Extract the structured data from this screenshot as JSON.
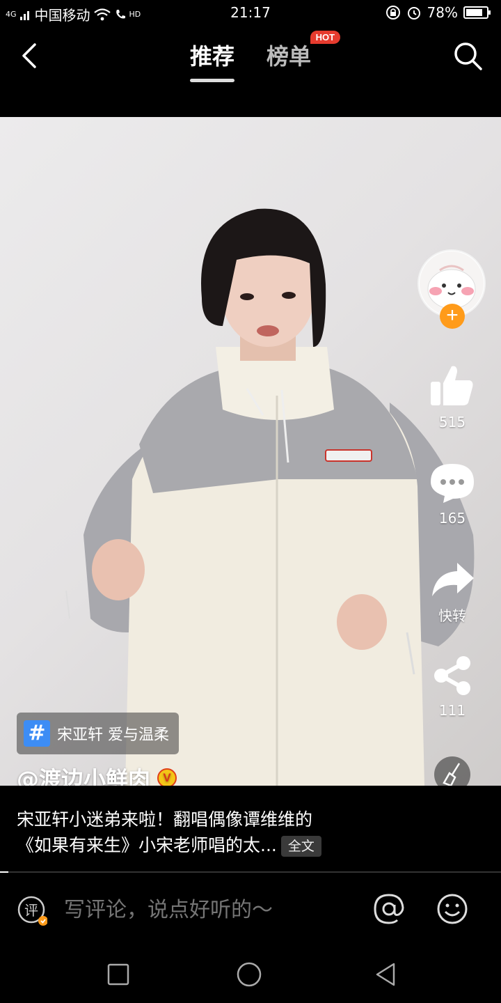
{
  "status_bar": {
    "network": "4G",
    "carrier": "中国移动",
    "call_badge": "HD",
    "time": "21:17",
    "battery": "78%"
  },
  "nav": {
    "tabs": [
      {
        "label": "推荐",
        "active": true
      },
      {
        "label": "榜单",
        "active": false
      }
    ],
    "hot_badge": "HOT"
  },
  "actions": {
    "like_count": "515",
    "comment_count": "165",
    "repost_label": "快转",
    "share_count": "111"
  },
  "topic": {
    "text": "宋亚轩 爱与温柔"
  },
  "author": {
    "name": "@渡边小鲜肉",
    "verified_mark": "V"
  },
  "caption": {
    "line1": "宋亚轩小迷弟来啦！翻唱偶像谭维维的",
    "line2": "《如果有来生》小宋老师唱的太...",
    "more_label": "全文"
  },
  "comment_bar": {
    "placeholder": "写评论，说点好听的～",
    "comment_icon_char": "评"
  },
  "colors": {
    "hot": "#e63b2e",
    "topic_hash": "#3d8df5",
    "follow_plus": "#ff9b1a",
    "verified": "#f5c518"
  }
}
